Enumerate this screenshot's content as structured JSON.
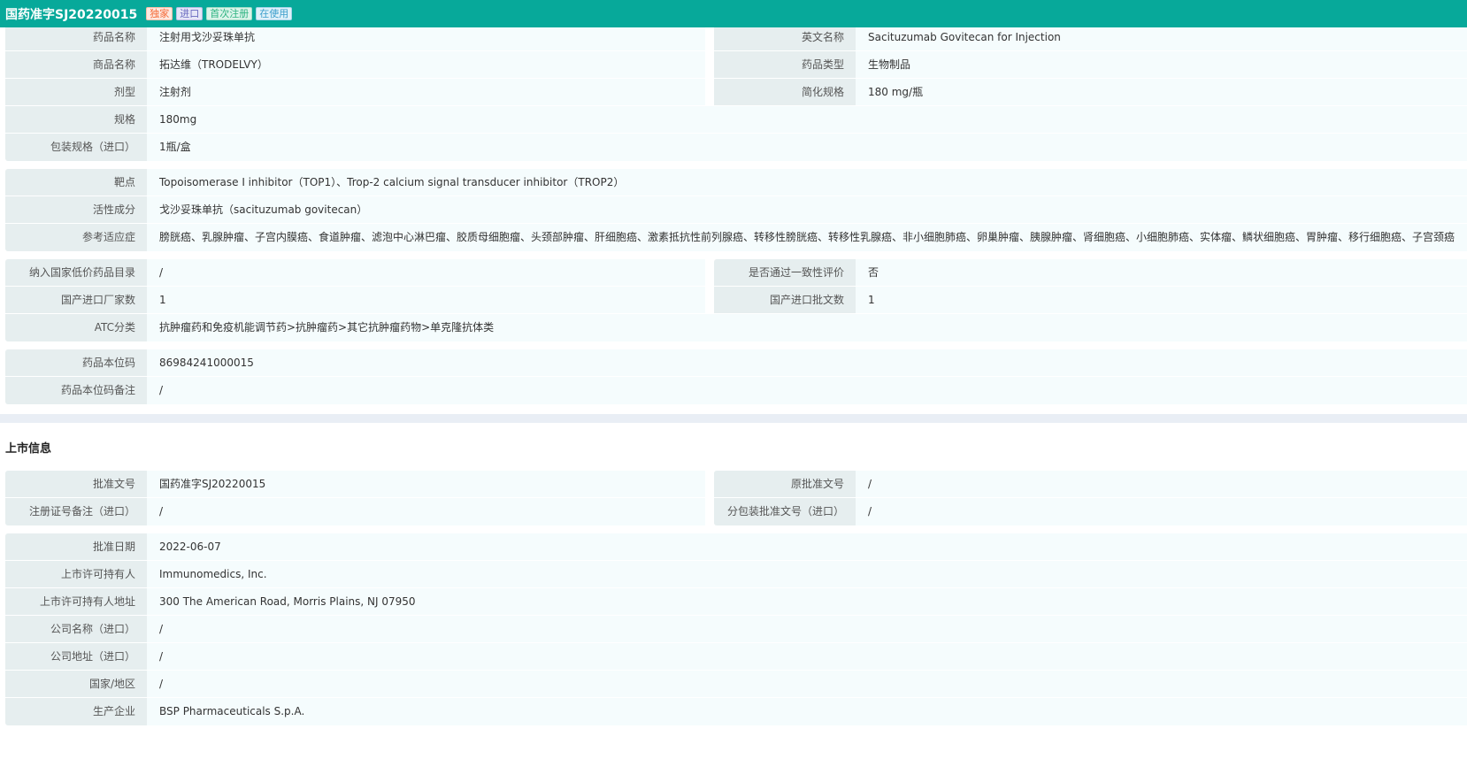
{
  "header": {
    "title": "国药准字SJ20220015",
    "tags": [
      {
        "label": "独家",
        "color": "#f56c3a",
        "bg": "#fde9e1"
      },
      {
        "label": "进口",
        "color": "#6a6bc0",
        "bg": "#e5e6f7"
      },
      {
        "label": "首次注册",
        "color": "#2fb482",
        "bg": "#dcf4ea"
      },
      {
        "label": "在使用",
        "color": "#3d9fcc",
        "bg": "#e0f1f9"
      }
    ]
  },
  "groups1": [
    [
      [
        [
          "药品名称",
          "注射用戈沙妥珠单抗"
        ],
        [
          "英文名称",
          "Sacituzumab Govitecan for Injection"
        ]
      ],
      [
        [
          "商品名称",
          "拓达维（TRODELVY）"
        ],
        [
          "药品类型",
          "生物制品"
        ]
      ],
      [
        [
          "剂型",
          "注射剂"
        ],
        [
          "简化规格",
          "180 mg/瓶"
        ]
      ],
      [
        [
          "规格",
          "180mg"
        ]
      ],
      [
        [
          "包装规格（进口）",
          "1瓶/盒"
        ]
      ]
    ],
    [
      [
        [
          "靶点",
          "Topoisomerase I inhibitor（TOP1）、Trop-2 calcium signal transducer inhibitor（TROP2）"
        ]
      ],
      [
        [
          "活性成分",
          "戈沙妥珠单抗（sacituzumab govitecan）"
        ]
      ],
      [
        [
          "参考适应症",
          "膀胱癌、乳腺肿瘤、子宫内膜癌、食道肿瘤、滤泡中心淋巴瘤、胶质母细胞瘤、头颈部肿瘤、肝细胞癌、激素抵抗性前列腺癌、转移性膀胱癌、转移性乳腺癌、非小细胞肺癌、卵巢肿瘤、胰腺肿瘤、肾细胞癌、小细胞肺癌、实体瘤、鳞状细胞癌、胃肿瘤、移行细胞癌、子宫颈癌"
        ]
      ]
    ],
    [
      [
        [
          "纳入国家低价药品目录",
          "/"
        ],
        [
          "是否通过一致性评价",
          "否"
        ]
      ],
      [
        [
          "国产进口厂家数",
          "1"
        ],
        [
          "国产进口批文数",
          "1"
        ]
      ],
      [
        [
          "ATC分类",
          "抗肿瘤药和免疫机能调节药>抗肿瘤药>其它抗肿瘤药物>单克隆抗体类"
        ]
      ]
    ],
    [
      [
        [
          "药品本位码",
          "86984241000015"
        ]
      ],
      [
        [
          "药品本位码备注",
          "/"
        ]
      ]
    ]
  ],
  "section2_title": "上市信息",
  "groups2": [
    [
      [
        [
          "批准文号",
          "国药准字SJ20220015"
        ],
        [
          "原批准文号",
          "/"
        ]
      ],
      [
        [
          "注册证号备注（进口）",
          "/"
        ],
        [
          "分包装批准文号（进口）",
          "/"
        ]
      ]
    ],
    [
      [
        [
          "批准日期",
          "2022-06-07"
        ]
      ],
      [
        [
          "上市许可持有人",
          "Immunomedics, Inc."
        ]
      ],
      [
        [
          "上市许可持有人地址",
          "300 The American Road, Morris Plains, NJ 07950"
        ]
      ],
      [
        [
          "公司名称（进口）",
          "/"
        ]
      ],
      [
        [
          "公司地址（进口）",
          "/"
        ]
      ],
      [
        [
          "国家/地区",
          "/"
        ]
      ],
      [
        [
          "生产企业",
          "BSP Pharmaceuticals S.p.A."
        ]
      ]
    ]
  ]
}
